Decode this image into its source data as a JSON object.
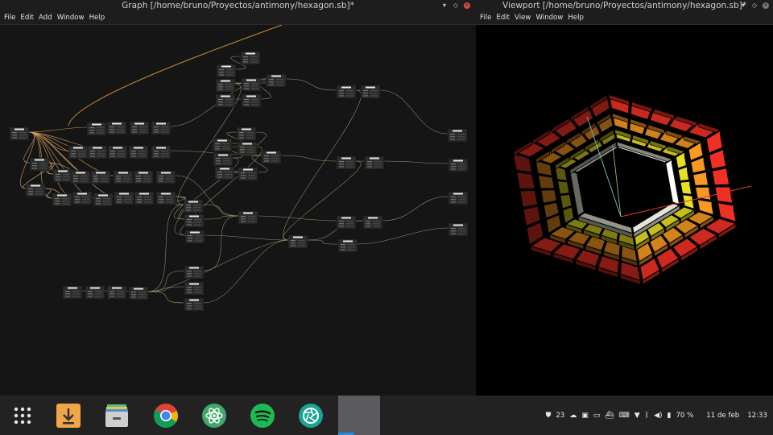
{
  "graph_window": {
    "title": "Graph [/home/bruno/Proyectos/antimony/hexagon.sb]*",
    "menu": [
      "File",
      "Edit",
      "Add",
      "Window",
      "Help"
    ],
    "controls": [
      "minimize",
      "maximize",
      "close"
    ]
  },
  "viewport_window": {
    "title": "Viewport [/home/bruno/Proyectos/antimony/hexagon.sb]*",
    "menu": [
      "File",
      "Edit",
      "View",
      "Window",
      "Help"
    ],
    "controls": [
      "minimize",
      "maximize",
      "close"
    ]
  },
  "hexagon_rings": {
    "outer": "#d12a20",
    "second": "#d8851c",
    "third": "#c8c21e",
    "inner": "#e8e8dc",
    "axis_x": "#e0392e",
    "axis_y": "#6fb7a8",
    "axis_z": "#9ccf8a"
  },
  "dock": {
    "apps": [
      {
        "name": "app-grid-icon"
      },
      {
        "name": "downloader-icon",
        "color": "#f0a646"
      },
      {
        "name": "archive-manager-icon",
        "color": "#cfcfcf"
      },
      {
        "name": "chrome-icon"
      },
      {
        "name": "atom-icon",
        "color": "#3fa86a"
      },
      {
        "name": "spotify-icon",
        "color": "#1db954"
      },
      {
        "name": "camera-app-icon",
        "color": "#1aa394"
      }
    ]
  },
  "tray": {
    "notification_count": "23",
    "battery": "70 %",
    "date": "11 de feb",
    "time": "12:33"
  }
}
